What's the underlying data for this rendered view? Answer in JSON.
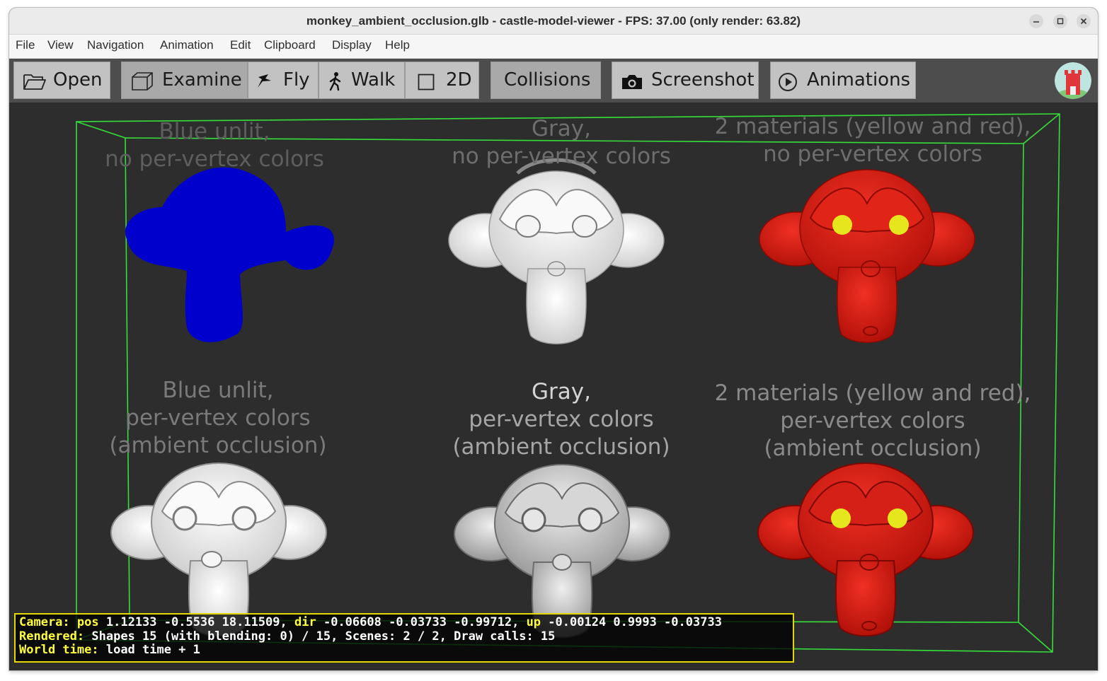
{
  "window": {
    "title": "monkey_ambient_occlusion.glb - castle-model-viewer - FPS: 37.00 (only render: 63.82)"
  },
  "menu": [
    "File",
    "View",
    "Navigation",
    "Animation",
    "Edit",
    "Clipboard",
    "Display",
    "Help"
  ],
  "toolbar": {
    "open": "Open",
    "examine": "Examine",
    "fly": "Fly",
    "walk": "Walk",
    "two_d": "2D",
    "collisions": "Collisions",
    "screenshot": "Screenshot",
    "animations": "Animations",
    "selected_navigation": "Examine"
  },
  "scene": {
    "bounding_box_color": "#35e03a",
    "captions": {
      "blue_unlit_line1": "Blue unlit,",
      "blue_unlit_line2": "no per-vertex colors",
      "gray_line1": "Gray,",
      "gray_line2": "no per-vertex colors",
      "two_mat_line1": "2 materials (yellow and red),",
      "two_mat_line2": "no per-vertex colors",
      "blue_unlit_ao_line1": "Blue unlit,",
      "blue_unlit_ao_line2": "per-vertex colors",
      "blue_unlit_ao_line3": "(ambient occlusion)",
      "gray_ao_line1": "Gray,",
      "gray_ao_line2": "per-vertex colors",
      "gray_ao_line3": "(ambient occlusion)",
      "two_mat_ao_line1": "2 materials (yellow and red),",
      "two_mat_ao_line2": "per-vertex colors",
      "two_mat_ao_line3": "(ambient occlusion)"
    },
    "monkey_colors": {
      "blue": "#0000cc",
      "gray": "#f2f2f2",
      "red": "#d81c10",
      "yellow": "#e6e61e"
    }
  },
  "hud": {
    "camera_label": "Camera:",
    "pos_label": "pos",
    "pos_value": "1.12133 -0.5536 18.11509,",
    "dir_label": "dir",
    "dir_value": "-0.06608 -0.03733 -0.99712,",
    "up_label": "up",
    "up_value": "-0.00124 0.9993 -0.03733",
    "rendered_label": "Rendered:",
    "rendered_value": "Shapes 15 (with blending: 0) / 15, Scenes: 2 / 2, Draw calls: 15",
    "world_time_label": "World time:",
    "world_time_value": "load time + 1"
  }
}
